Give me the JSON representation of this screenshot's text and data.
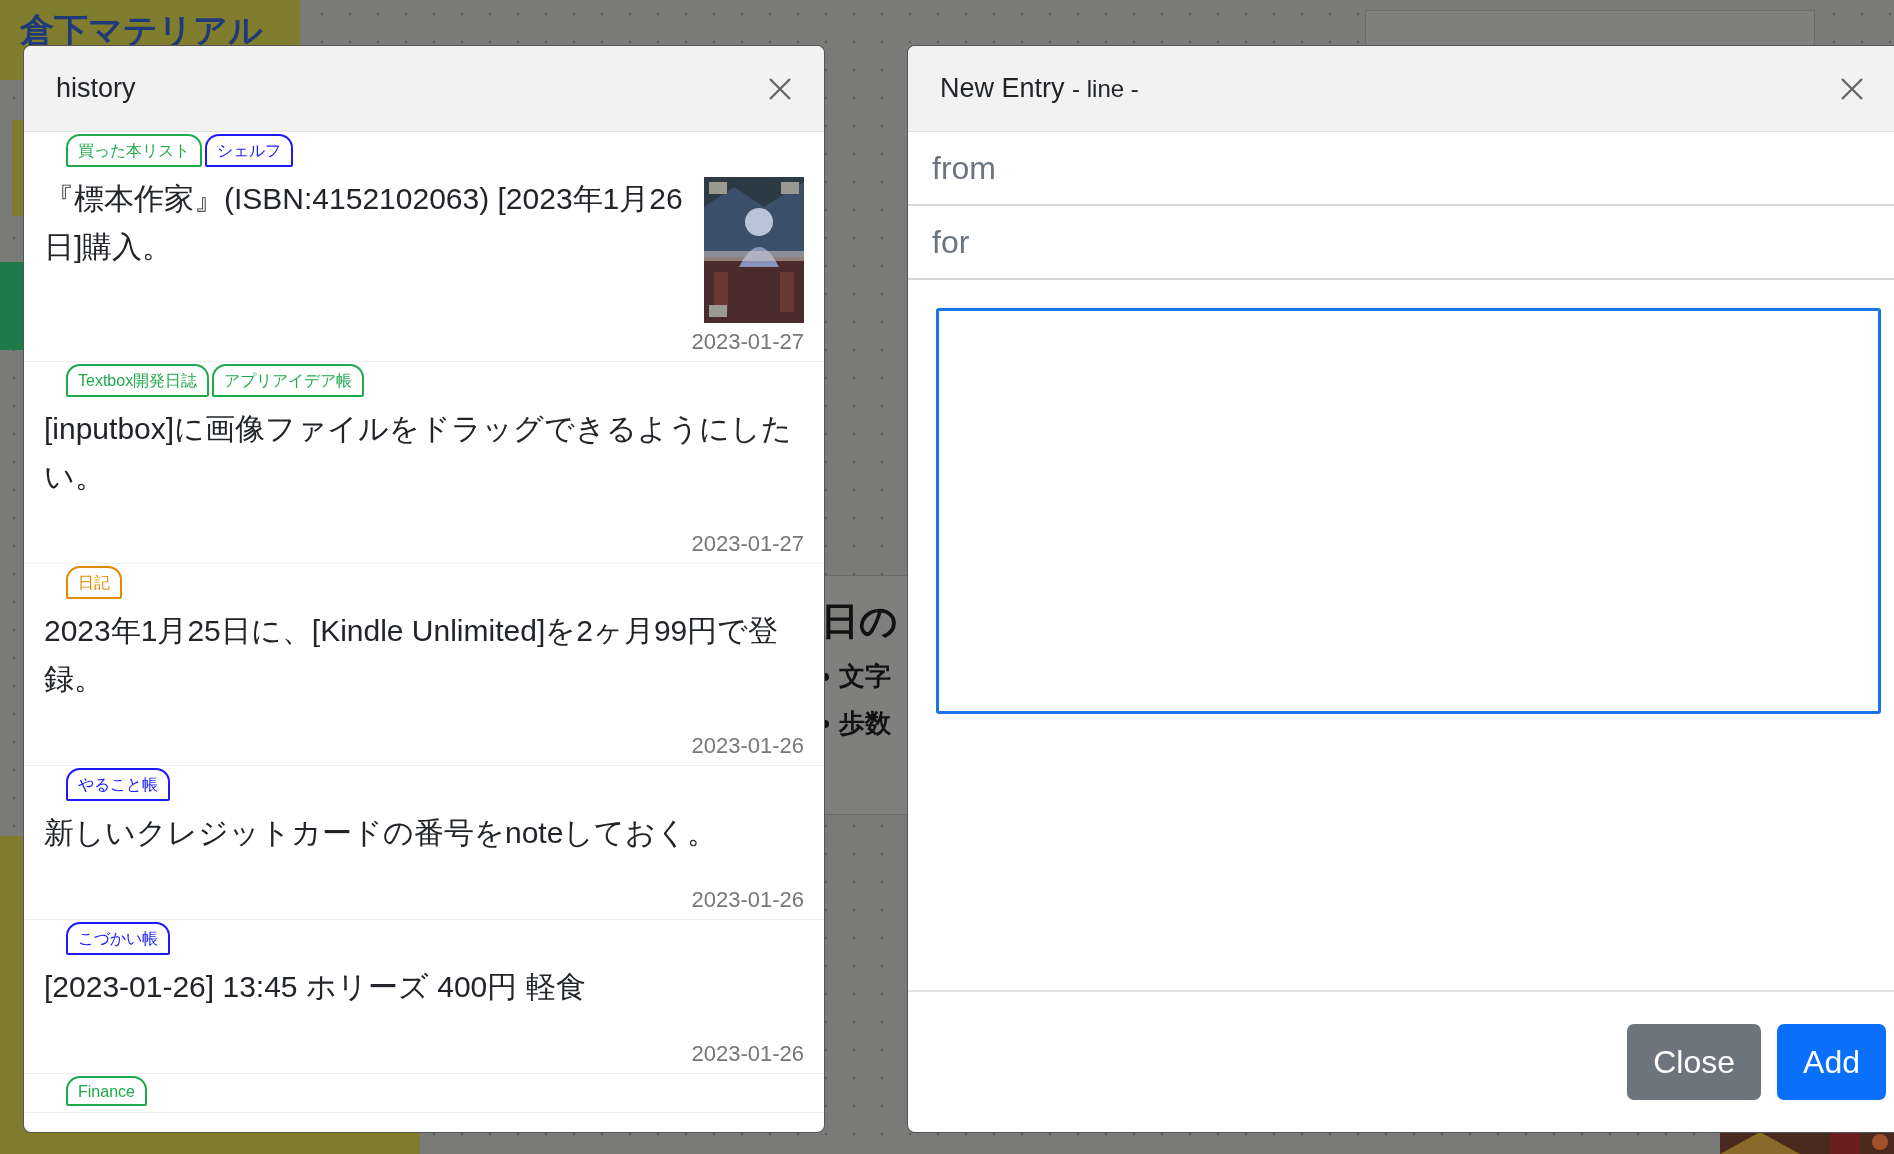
{
  "background": {
    "board_title": "倉下マテリアル",
    "card_heading": "日の",
    "card_items": [
      "文字",
      "歩数"
    ]
  },
  "history": {
    "title": "history",
    "entries": [
      {
        "tags": [
          {
            "label": "買った本リスト",
            "color": "#1fa94a"
          },
          {
            "label": "シェルフ",
            "color": "#1a1aff"
          }
        ],
        "text": "『標本作家』(ISBN:4152102063) [2023年1月26日]購入。",
        "date": "2023-01-27"
      },
      {
        "tags": [
          {
            "label": "Textbox開発日誌",
            "color": "#1fa94a"
          },
          {
            "label": "アプリアイデア帳",
            "color": "#1fa94a"
          }
        ],
        "text": "[inputbox]に画像ファイルをドラッグできるようにしたい。",
        "date": "2023-01-27"
      },
      {
        "tags": [
          {
            "label": "日記",
            "color": "#e08a00"
          }
        ],
        "text": "2023年1月25日に、[Kindle Unlimited]を2ヶ月99円で登録。",
        "date": "2023-01-26"
      },
      {
        "tags": [
          {
            "label": "やること帳",
            "color": "#1a1aff"
          }
        ],
        "text": "新しいクレジットカードの番号をnoteしておく。",
        "date": "2023-01-26"
      },
      {
        "tags": [
          {
            "label": "こづかい帳",
            "color": "#1a1aff"
          }
        ],
        "text": "[2023-01-26] 13:45 ホリーズ 400円 軽食",
        "date": "2023-01-26"
      },
      {
        "tags": [
          {
            "label": "Finance",
            "color": "#1fa94a"
          }
        ]
      }
    ]
  },
  "new_entry": {
    "title": "New Entry",
    "subtitle": "- line -",
    "from": {
      "placeholder": "from"
    },
    "for": {
      "placeholder": "for"
    },
    "body": {
      "focused": true
    },
    "buttons": [
      {
        "label": "Close",
        "kind": "secondary"
      },
      {
        "label": "Add",
        "kind": "primary"
      }
    ]
  }
}
